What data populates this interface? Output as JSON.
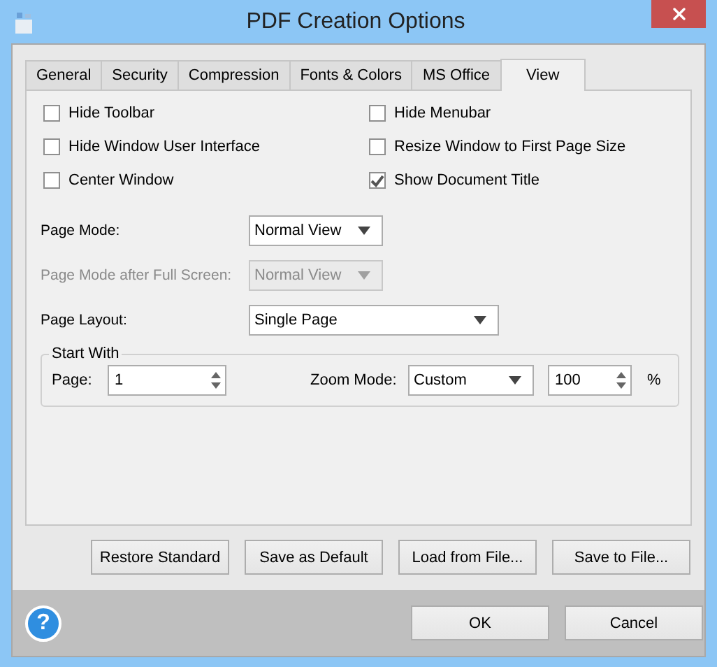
{
  "window": {
    "title": "PDF Creation Options"
  },
  "tabs": [
    {
      "label": "General",
      "selected": false
    },
    {
      "label": "Security",
      "selected": false
    },
    {
      "label": "Compression",
      "selected": false
    },
    {
      "label": "Fonts & Colors",
      "selected": false
    },
    {
      "label": "MS Office",
      "selected": false
    },
    {
      "label": "View",
      "selected": true
    }
  ],
  "options": [
    {
      "label": "Hide Toolbar",
      "checked": false
    },
    {
      "label": "Hide Menubar",
      "checked": false
    },
    {
      "label": "Hide Window User Interface",
      "checked": false
    },
    {
      "label": "Resize Window to First Page Size",
      "checked": false
    },
    {
      "label": "Center Window",
      "checked": false
    },
    {
      "label": "Show Document Title",
      "checked": true
    }
  ],
  "fields": [
    {
      "label": "Page Mode:",
      "value": "Normal View",
      "disabled": false
    },
    {
      "label": "Page Mode after Full Screen:",
      "value": "Normal View",
      "disabled": true
    },
    {
      "label": "Page Layout:",
      "value": "Single Page",
      "disabled": false
    }
  ],
  "start_with": {
    "title": "Start With",
    "page": {
      "label": "Page:",
      "value": "1"
    },
    "zoom_mode": {
      "label": "Zoom Mode:",
      "value": "Custom"
    },
    "zoom": {
      "value": "100",
      "unit": "%"
    }
  },
  "actions": [
    "Restore Standard",
    "Save as Default",
    "Load from File...",
    "Save to File..."
  ],
  "help": "?",
  "dialog_buttons": [
    "OK",
    "Cancel"
  ]
}
